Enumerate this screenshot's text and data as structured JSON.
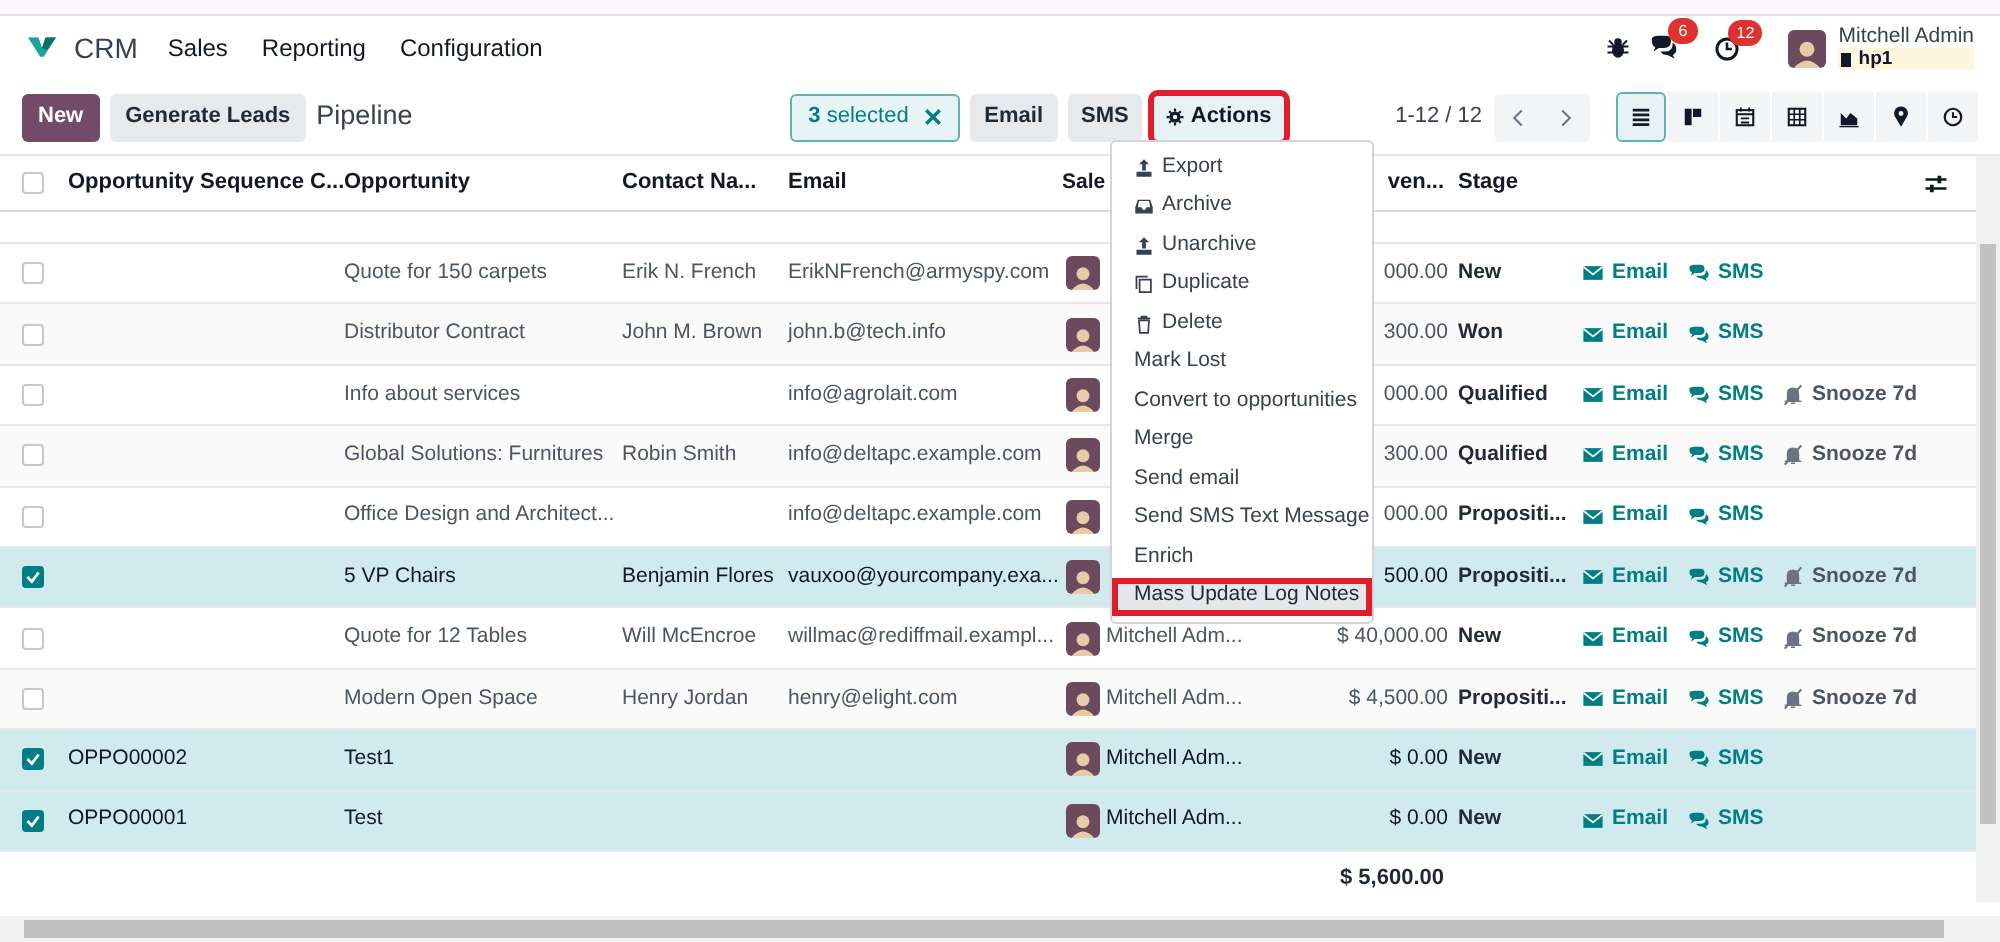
{
  "navbar": {
    "app": "CRM",
    "menus": [
      "Sales",
      "Reporting",
      "Configuration"
    ],
    "messages_count": "6",
    "activities_count": "12",
    "user": {
      "name": "Mitchell Admin",
      "company": "hp1"
    }
  },
  "control_panel": {
    "buttons": [
      {
        "label": "New",
        "kind": "primary"
      },
      {
        "label": "Generate Leads",
        "kind": "secondary"
      }
    ],
    "breadcrumb": "Pipeline",
    "selection": "**3** selected",
    "action_buttons": [
      {
        "label": "Email",
        "kind": "email",
        "outlined": false
      },
      {
        "label": "SMS",
        "kind": "sms",
        "outlined": false
      },
      {
        "label": "Actions",
        "kind": "actions",
        "outlined": true
      }
    ],
    "pager": "1-12 / 12",
    "views": [
      {
        "kind": "list",
        "selected": true
      },
      {
        "kind": "kanban",
        "selected": false
      },
      {
        "kind": "calendar",
        "selected": false
      },
      {
        "kind": "pivot",
        "selected": false
      },
      {
        "kind": "graph",
        "selected": false
      },
      {
        "kind": "map",
        "selected": false
      },
      {
        "kind": "activity",
        "selected": false
      }
    ]
  },
  "table": {
    "all_selected": false,
    "columns": [
      "Opportunity Sequence C...",
      "Opportunity",
      "Contact Na...",
      "Email",
      "Sale",
      "ven...",
      "Stage"
    ],
    "rows": [
      {
        "selected": false,
        "sequence": "",
        "opportunity": "Quote for 150 carpets",
        "contact": "Erik N. French",
        "email": "ErikNFrench@armyspy.com",
        "salesperson": "",
        "revenue": "000.00",
        "stage": "New",
        "actions": [
          {
            "kind": "email",
            "label": "Email"
          },
          {
            "kind": "sms",
            "label": "SMS"
          }
        ]
      },
      {
        "selected": false,
        "sequence": "",
        "opportunity": "Distributor Contract",
        "contact": "John M. Brown",
        "email": "john.b@tech.info",
        "salesperson": "",
        "revenue": "300.00",
        "stage": "Won",
        "actions": [
          {
            "kind": "email",
            "label": "Email"
          },
          {
            "kind": "sms",
            "label": "SMS"
          }
        ]
      },
      {
        "selected": false,
        "sequence": "",
        "opportunity": "Info about services",
        "contact": "",
        "email": "info@agrolait.com",
        "salesperson": "",
        "revenue": "000.00",
        "stage": "Qualified",
        "actions": [
          {
            "kind": "email",
            "label": "Email"
          },
          {
            "kind": "sms",
            "label": "SMS"
          },
          {
            "kind": "snooze",
            "label": "Snooze 7d"
          }
        ]
      },
      {
        "selected": false,
        "sequence": "",
        "opportunity": "Global Solutions: Furnitures",
        "contact": "Robin Smith",
        "email": "info@deltapc.example.com",
        "salesperson": "",
        "revenue": "300.00",
        "stage": "Qualified",
        "actions": [
          {
            "kind": "email",
            "label": "Email"
          },
          {
            "kind": "sms",
            "label": "SMS"
          },
          {
            "kind": "snooze",
            "label": "Snooze 7d"
          }
        ]
      },
      {
        "selected": false,
        "sequence": "",
        "opportunity": "Office Design and Architect...",
        "contact": "",
        "email": "info@deltapc.example.com",
        "salesperson": "",
        "revenue": "000.00",
        "stage": "Propositi...",
        "actions": [
          {
            "kind": "email",
            "label": "Email"
          },
          {
            "kind": "sms",
            "label": "SMS"
          }
        ]
      },
      {
        "selected": true,
        "sequence": "",
        "opportunity": "5 VP Chairs",
        "contact": "Benjamin Flores",
        "email": "vauxoo@yourcompany.exa...",
        "salesperson": "",
        "revenue": "500.00",
        "stage": "Propositi...",
        "actions": [
          {
            "kind": "email",
            "label": "Email"
          },
          {
            "kind": "sms",
            "label": "SMS"
          },
          {
            "kind": "snooze",
            "label": "Snooze 7d"
          }
        ]
      },
      {
        "selected": false,
        "sequence": "",
        "opportunity": "Quote for 12 Tables",
        "contact": "Will McEncroe",
        "email": "willmac@rediffmail.exampl...",
        "salesperson": "Mitchell Adm...",
        "revenue": "$ 40,000.00",
        "stage": "New",
        "actions": [
          {
            "kind": "email",
            "label": "Email"
          },
          {
            "kind": "sms",
            "label": "SMS"
          },
          {
            "kind": "snooze",
            "label": "Snooze 7d"
          }
        ]
      },
      {
        "selected": false,
        "sequence": "",
        "opportunity": "Modern Open Space",
        "contact": "Henry Jordan",
        "email": "henry@elight.com",
        "salesperson": "Mitchell Adm...",
        "revenue": "$ 4,500.00",
        "stage": "Propositi...",
        "actions": [
          {
            "kind": "email",
            "label": "Email"
          },
          {
            "kind": "sms",
            "label": "SMS"
          },
          {
            "kind": "snooze",
            "label": "Snooze 7d"
          }
        ]
      },
      {
        "selected": true,
        "sequence": "OPPO00002",
        "opportunity": "Test1",
        "contact": "",
        "email": "",
        "salesperson": "Mitchell Adm...",
        "revenue": "$ 0.00",
        "stage": "New",
        "actions": [
          {
            "kind": "email",
            "label": "Email"
          },
          {
            "kind": "sms",
            "label": "SMS"
          }
        ]
      },
      {
        "selected": true,
        "sequence": "OPPO00001",
        "opportunity": "Test",
        "contact": "",
        "email": "",
        "salesperson": "Mitchell Adm...",
        "revenue": "$ 0.00",
        "stage": "New",
        "actions": [
          {
            "kind": "email",
            "label": "Email"
          },
          {
            "kind": "sms",
            "label": "SMS"
          }
        ]
      }
    ],
    "total": "$ 5,600.00"
  },
  "actions_menu": {
    "items": [
      {
        "label": "Export",
        "kind": "export",
        "highlighted": false
      },
      {
        "label": "Archive",
        "kind": "archive",
        "highlighted": false
      },
      {
        "label": "Unarchive",
        "kind": "unarchive",
        "highlighted": false
      },
      {
        "label": "Duplicate",
        "kind": "duplicate",
        "highlighted": false
      },
      {
        "label": "Delete",
        "kind": "delete",
        "highlighted": false
      },
      {
        "label": "Mark Lost",
        "kind": "plain",
        "highlighted": false
      },
      {
        "label": "Convert to opportunities",
        "kind": "plain",
        "highlighted": false
      },
      {
        "label": "Merge",
        "kind": "plain",
        "highlighted": false
      },
      {
        "label": "Send email",
        "kind": "plain",
        "highlighted": false
      },
      {
        "label": "Send SMS Text Message",
        "kind": "plain",
        "highlighted": false
      },
      {
        "label": "Enrich",
        "kind": "plain",
        "highlighted": false
      },
      {
        "label": "Mass Update Log Notes",
        "kind": "plain",
        "highlighted": true
      }
    ]
  }
}
